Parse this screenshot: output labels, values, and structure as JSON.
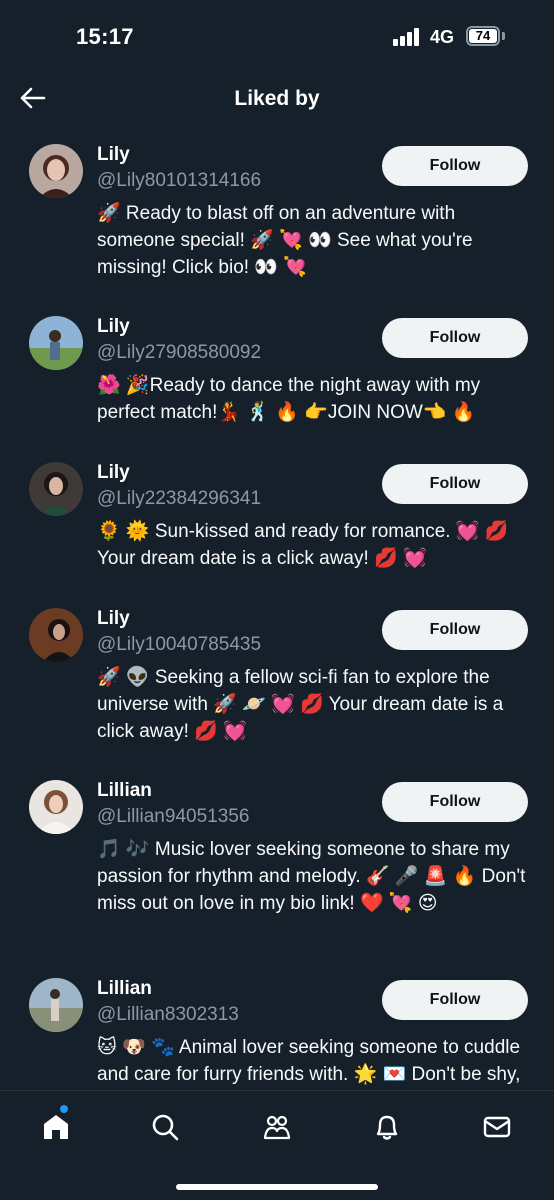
{
  "status_bar": {
    "time": "15:17",
    "network": "4G",
    "battery": "74"
  },
  "header": {
    "title": "Liked by"
  },
  "users": [
    {
      "name": "Lily",
      "handle": "@Lily80101314166",
      "follow_label": "Follow",
      "bio": "🚀 Ready to blast off on an adventure with someone special! 🚀 💘 👀 See what you're missing! Click bio! 👀 💘"
    },
    {
      "name": "Lily",
      "handle": "@Lily27908580092",
      "follow_label": "Follow",
      "bio": "🌺 🎉Ready to dance the night away with my perfect match!💃 🕺 🔥 👉JOIN NOW👈 🔥"
    },
    {
      "name": "Lily",
      "handle": "@Lily22384296341",
      "follow_label": "Follow",
      "bio": "🌻 🌞 Sun-kissed and ready for romance. 💓 💋 Your dream date is a click away! 💋 💓"
    },
    {
      "name": "Lily",
      "handle": "@Lily10040785435",
      "follow_label": "Follow",
      "bio": "🚀 👽 Seeking a fellow sci-fi fan to explore the universe with 🚀 🪐 💓 💋 Your dream date is a click away! 💋 💓"
    },
    {
      "name": "Lillian",
      "handle": "@Lillian94051356",
      "follow_label": "Follow",
      "bio": "🎵 🎶 Music lover seeking someone to share my passion for rhythm and melody. 🎸 🎤 🚨 🔥 Don't miss out on love in my bio link! ❤️ 💘 😍"
    },
    {
      "name": "Lillian",
      "handle": "@Lillian8302313",
      "follow_label": "Follow",
      "bio": "🐱 🐶 🐾 Animal lover seeking someone to cuddle and care for furry friends with. 🌟 💌 Don't be shy, click my bio! 💌 🌟"
    }
  ],
  "tabs": [
    "home-tab",
    "search-tab",
    "communities-tab",
    "notifications-tab",
    "messages-tab"
  ]
}
